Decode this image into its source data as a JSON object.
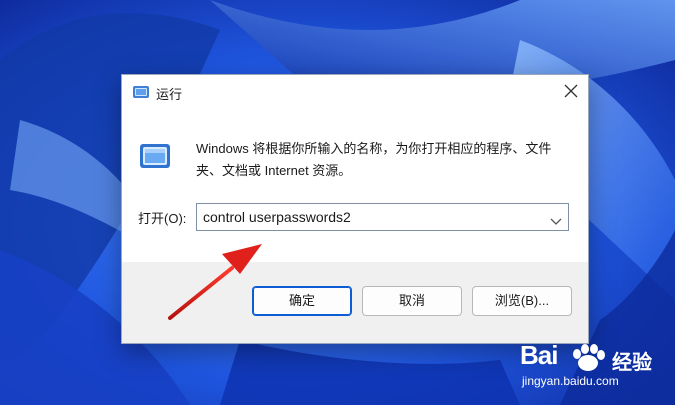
{
  "dialog": {
    "title": "运行",
    "description": "Windows 将根据你所输入的名称，为你打开相应的程序、文件夹、文档或 Internet 资源。",
    "open_label": "打开(O):",
    "open_value": "control userpasswords2",
    "buttons": {
      "ok": "确定",
      "cancel": "取消",
      "browse": "浏览(B)..."
    }
  },
  "icons": {
    "title": "run-icon",
    "main": "run-icon",
    "close": "close-icon",
    "dropdown": "chevron-down-icon"
  },
  "watermark": {
    "brand": "Bai",
    "brand2": "经验",
    "url": "jingyan.baidu.com"
  },
  "colors": {
    "accent": "#0b5cd5",
    "annotation_arrow": "#e0201b",
    "wallpaper": "#1b4fd8"
  }
}
